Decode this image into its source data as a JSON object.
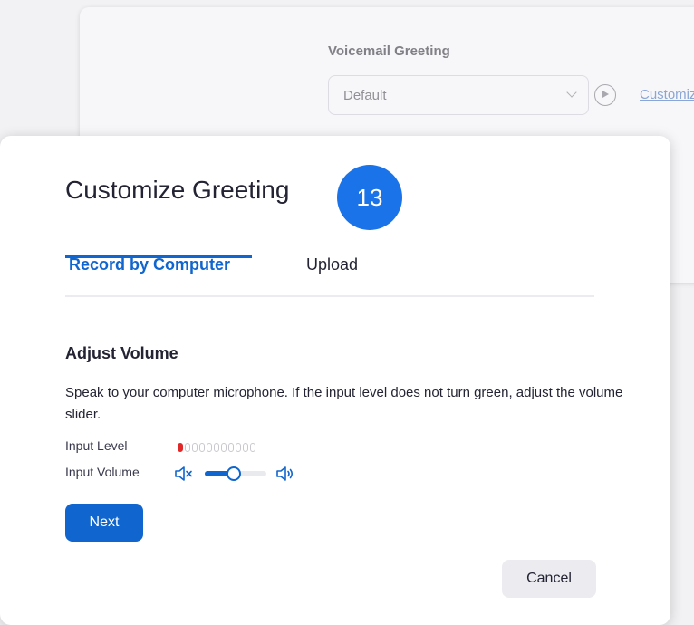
{
  "background": {
    "label": "Voicemail Greeting",
    "select_value": "Default",
    "link_text": "Customize"
  },
  "modal": {
    "title": "Customize Greeting",
    "step_badge": "13",
    "tabs": [
      {
        "label": "Record by Computer",
        "active": true
      },
      {
        "label": "Upload",
        "active": false
      }
    ],
    "section_title": "Adjust Volume",
    "description": "Speak to your computer microphone. If the input level does not turn green, adjust the volume slider.",
    "input_level_label": "Input Level",
    "input_level": {
      "active_segments": 1,
      "total_segments": 11
    },
    "input_volume_label": "Input Volume",
    "input_volume_value": 0.47,
    "next_label": "Next",
    "cancel_label": "Cancel"
  },
  "colors": {
    "accent": "#1066ce",
    "badge": "#1a73e8",
    "level_active": "#e02828"
  }
}
